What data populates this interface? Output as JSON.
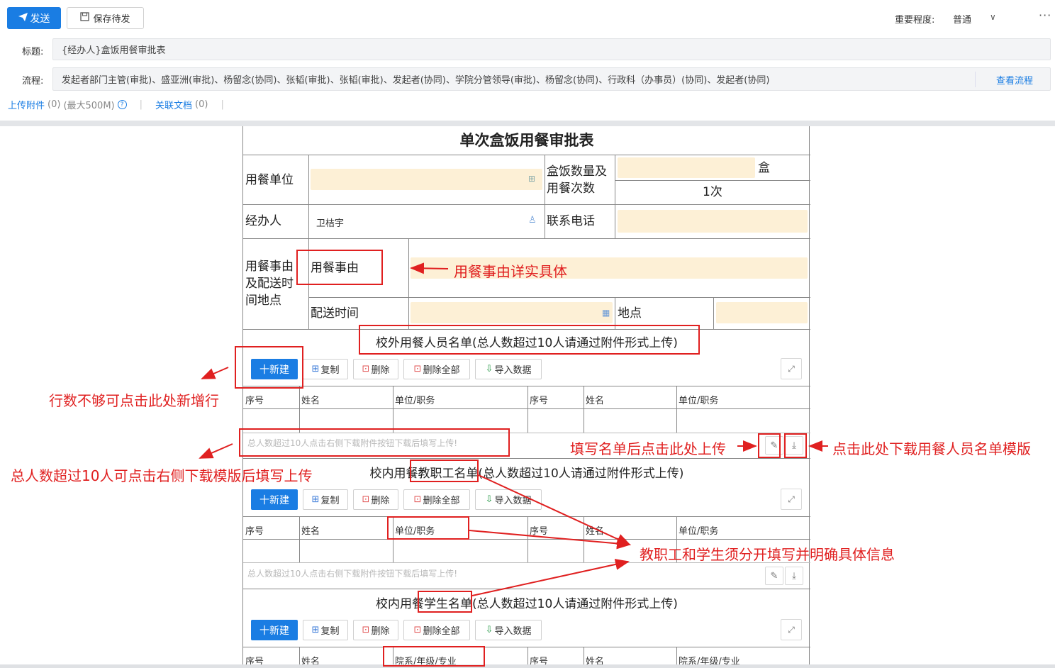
{
  "toolbar": {
    "send_label": "发送",
    "save_label": "保存待发",
    "importance_label": "重要程度:",
    "importance_value": "普通",
    "more": "···"
  },
  "header": {
    "title_label": "标题:",
    "title_value": "{经办人}盒饭用餐审批表",
    "flow_label": "流程:",
    "flow_value": "发起者部门主管(审批)、盛亚洲(审批)、杨留念(协同)、张韬(审批)、张韬(审批)、发起者(协同)、学院分管领导(审批)、杨留念(协同)、行政科（办事员）(协同)、发起者(协同)",
    "view_flow": "查看流程",
    "upload_label": "上传附件",
    "upload_count": "(0)",
    "upload_max": "(最大500M)",
    "related_label": "关联文档",
    "related_count": "(0)"
  },
  "form": {
    "title": "单次盒饭用餐审批表",
    "dining_unit": "用餐单位",
    "box_count_label": "盒饭数量及用餐次数",
    "box_unit": "盒",
    "times_value": "1次",
    "handler_label": "经办人",
    "handler_value": "卫桔宇",
    "phone_label": "联系电话",
    "reason_group_label": "用餐事由及配送时间地点",
    "reason_label": "用餐事由",
    "delivery_time_label": "配送时间",
    "location_label": "地点",
    "tables": [
      {
        "title": "校外用餐人员名单(总人数超过10人请通过附件形式上传)",
        "col3": "单位/职务",
        "hint": "总人数超过10人点击右侧下载附件按钮下载后填写上传!"
      },
      {
        "title": "校内用餐教职工名单(总人数超过10人请通过附件形式上传)",
        "col3": "单位/职务",
        "hint": "总人数超过10人点击右侧下载附件按钮下载后填写上传!"
      },
      {
        "title": "校内用餐学生名单(总人数超过10人请通过附件形式上传)",
        "col3": "院系/年级/专业",
        "hint": ""
      }
    ],
    "buttons": {
      "new": "十新建",
      "copy": "复制",
      "delete": "删除",
      "delete_all": "删除全部",
      "import": "导入数据"
    },
    "columns": {
      "seq": "序号",
      "name": "姓名"
    }
  },
  "annotations": {
    "reason_detail": "用餐事由详实具体",
    "add_row": "行数不够可点击此处新增行",
    "over_ten": "总人数超过10人可点击右侧下载模版后填写上传",
    "upload_after": "填写名单后点击此处上传",
    "download_template": "点击此处下载用餐人员名单模版",
    "separate": "教职工和学生须分开填写并明确具体信息"
  },
  "colors": {
    "primary": "#1a7de3",
    "annotation_red": "#e02020",
    "field_yellow": "#fdf0d6"
  }
}
